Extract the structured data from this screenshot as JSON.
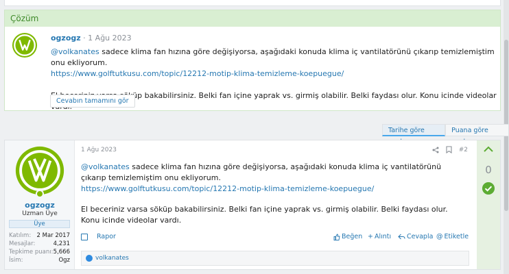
{
  "solution": {
    "header": "Çözüm",
    "username": "ogzogz",
    "separator": "·",
    "date": "1 Ağu 2023",
    "mention": "@volkanates",
    "line1_text": " sadece klima fan hızına göre değişiyorsa, aşağıdaki konuda klima iç vantilatörünü çıkarıp temizlemiştim onu ekliyorum.",
    "link": "https://www.golftutkusu.com/topic/12212-motip-klima-temizleme-koepuegue/",
    "line2": "El beceriniz varsa söküp bakabilirsiniz. Belki fan içine yaprak vs. girmiş olabilir. Belki faydası olur. Konu icinde videolar vardı.",
    "expand_button": "Cevabın tamamını gör"
  },
  "sort": {
    "by_date": "Tarihe göre sırala",
    "by_score": "Puana göre sırala"
  },
  "post": {
    "user": {
      "name": "ogzogz",
      "title": "Uzman Üye",
      "badge": "Üye",
      "stats": [
        {
          "label": "Katılım:",
          "value": "2 Mar 2017"
        },
        {
          "label": "Mesajlar:",
          "value": "4,231"
        },
        {
          "label": "Tepkime puanı:",
          "value": "5,666"
        },
        {
          "label": "İsim:",
          "value": "Ogz"
        }
      ]
    },
    "date": "1 Ağu 2023",
    "number": "#2",
    "mention": "@volkanates",
    "line1_text": " sadece klima fan hızına göre değişiyorsa, aşağıdaki konuda klima iç vantilatörünü çıkarıp temizlemiştim onu ekliyorum.",
    "link": "https://www.golftutkusu.com/topic/12212-motip-klima-temizleme-koepuegue/",
    "line2": "El beceriniz varsa söküp bakabilirsiniz. Belki fan içine yaprak vs. girmiş olabilir. Belki faydası olur. Konu icinde videolar vardı.",
    "actions": {
      "report": "Rapor",
      "like": "Beğen",
      "quote": "Alıntı",
      "reply": "Cevapla",
      "tag": "Etiketle"
    },
    "reaction_user": "volkanates",
    "votes": "0"
  },
  "colors": {
    "accent": "#2577b1",
    "solution_green": "#3f8a2a",
    "avatar_green": "#7fb900",
    "check_green": "#5cac33"
  }
}
